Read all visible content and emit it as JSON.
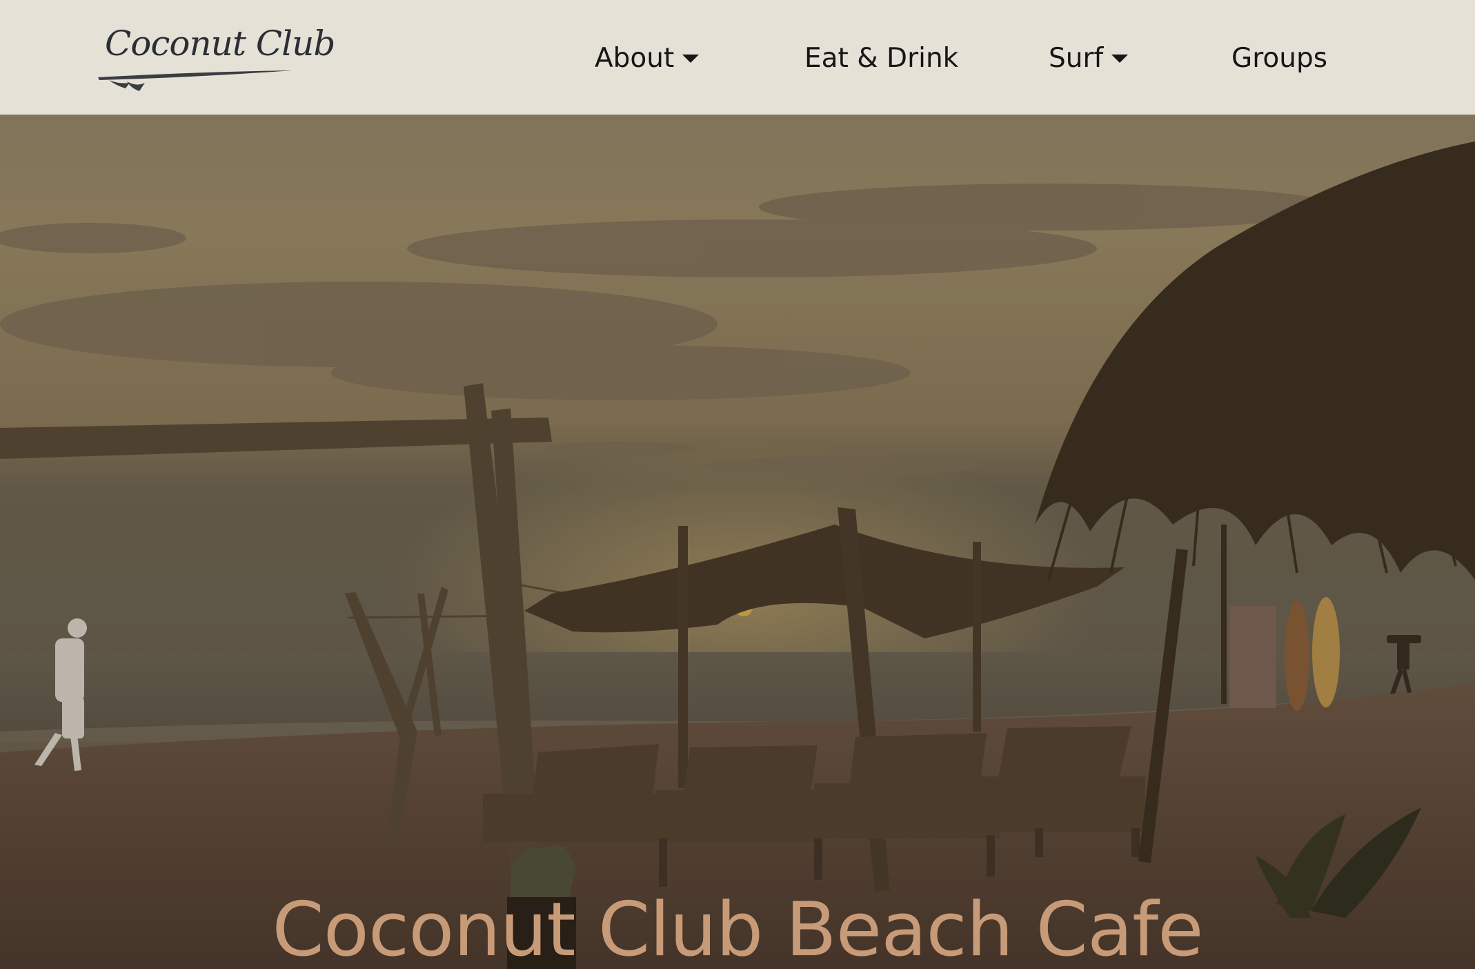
{
  "header": {
    "logo_text": "Coconut Club",
    "nav": [
      {
        "label": "About",
        "has_dropdown": true,
        "icon": "caret-down-icon"
      },
      {
        "label": "Eat & Drink",
        "has_dropdown": false
      },
      {
        "label": "Surf",
        "has_dropdown": true,
        "icon": "caret-down-icon"
      },
      {
        "label": "Groups",
        "has_dropdown": false
      }
    ]
  },
  "hero": {
    "title": "Coconut Club Beach Cafe",
    "photo_subject": "sunset-beach-with-loungers-and-palm-umbrella",
    "title_color": "#c79a78"
  },
  "colors": {
    "header_bg": "#ece8df",
    "nav_text": "#161616",
    "logo_text": "#2b2e33"
  }
}
